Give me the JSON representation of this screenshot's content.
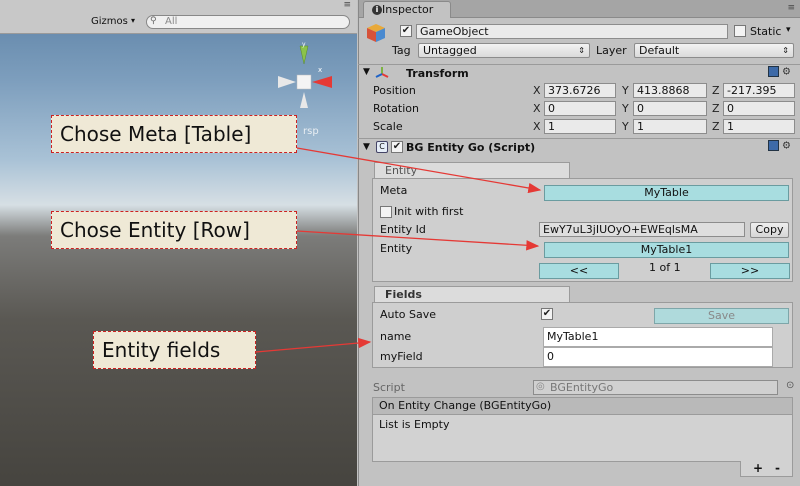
{
  "scene": {
    "gizmos_label": "Gizmos",
    "gizmos_caret": "▾",
    "search_placeholder": "All",
    "persp_label": "rsp",
    "menu_icon": "≡"
  },
  "callouts": {
    "meta": "Chose Meta [Table]",
    "entity": "Chose Entity [Row]",
    "fields": "Entity fields"
  },
  "inspector": {
    "tab_label": "Inspector",
    "tab_icon": "i",
    "menu_icon": "≡",
    "gameobject": {
      "name": "GameObject",
      "active": true,
      "static_label": "Static",
      "static_caret": "▾",
      "tag_label": "Tag",
      "tag_value": "Untagged",
      "layer_label": "Layer",
      "layer_value": "Default",
      "dropdown_caret": "⇕"
    },
    "transform": {
      "title": "Transform",
      "position_label": "Position",
      "rotation_label": "Rotation",
      "scale_label": "Scale",
      "axis_x": "X",
      "axis_y": "Y",
      "axis_z": "Z",
      "position": {
        "x": "373.6726",
        "y": "413.8868",
        "z": "-217.395"
      },
      "rotation": {
        "x": "0",
        "y": "0",
        "z": "0"
      },
      "scale": {
        "x": "1",
        "y": "1",
        "z": "1"
      }
    },
    "script_component": {
      "title": "BG Entity Go (Script)",
      "enabled": true,
      "entity_panel": {
        "tab": "Entity",
        "meta_label": "Meta",
        "meta_value": "MyTable",
        "init_with_first_label": "Init with first",
        "entity_id_label": "Entity Id",
        "entity_id_value": "EwY7uL3jIUOyO+EWEqlsMA",
        "copy_label": "Copy",
        "entity_label": "Entity",
        "entity_value": "MyTable1",
        "prev_label": "<<",
        "next_label": ">>",
        "pager": "1 of 1"
      },
      "fields_panel": {
        "tab": "Fields",
        "auto_save_label": "Auto Save",
        "auto_save": true,
        "save_label": "Save",
        "name_label": "name",
        "name_value": "MyTable1",
        "myfield_label": "myField",
        "myfield_value": "0"
      },
      "script_label": "Script",
      "script_value": "BGEntityGo",
      "event_header": "On Entity Change (BGEntityGo)",
      "event_empty": "List is Empty",
      "add_label": "+",
      "remove_label": "-"
    }
  },
  "colors": {
    "cyan_button": "#a8dde0",
    "callout_border": "#cc2222",
    "callout_bg": "#efe9d6"
  }
}
